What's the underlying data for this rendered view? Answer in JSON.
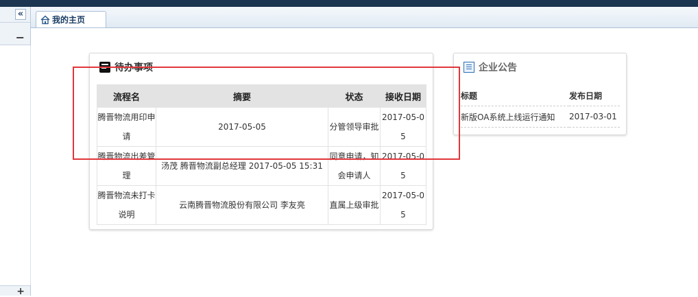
{
  "tabs": [
    {
      "label": "我的主页"
    }
  ],
  "todo": {
    "title": "待办事项",
    "columns": [
      "流程名",
      "摘要",
      "状态",
      "接收日期"
    ],
    "rows": [
      {
        "name": "腾晋物流用印申请",
        "summary": "2017-05-05",
        "status": "分管领导审批",
        "date": "2017-05-05"
      },
      {
        "name": "腾晋物流出差管理",
        "summary": "汤茂 腾晋物流副总经理 2017-05-05 15:31",
        "status": "同意申请，知会申请人",
        "date": "2017-05-05"
      },
      {
        "name": "腾晋物流未打卡说明",
        "summary": "云南腾晋物流股份有限公司 李友亮",
        "status": "直属上级审批",
        "date": "2017-05-05"
      }
    ]
  },
  "notice": {
    "title": "企业公告",
    "columns": [
      "标题",
      "发布日期"
    ],
    "rows": [
      {
        "title": "新版OA系统上线运行通知",
        "date": "2017-03-01"
      }
    ]
  },
  "sidebar": {
    "collapse_glyph": "«",
    "section_glyph": "−",
    "bottom_glyph": "+"
  },
  "colors": {
    "annotation": "#e0353a",
    "tab_accent": "#1b3d63"
  }
}
